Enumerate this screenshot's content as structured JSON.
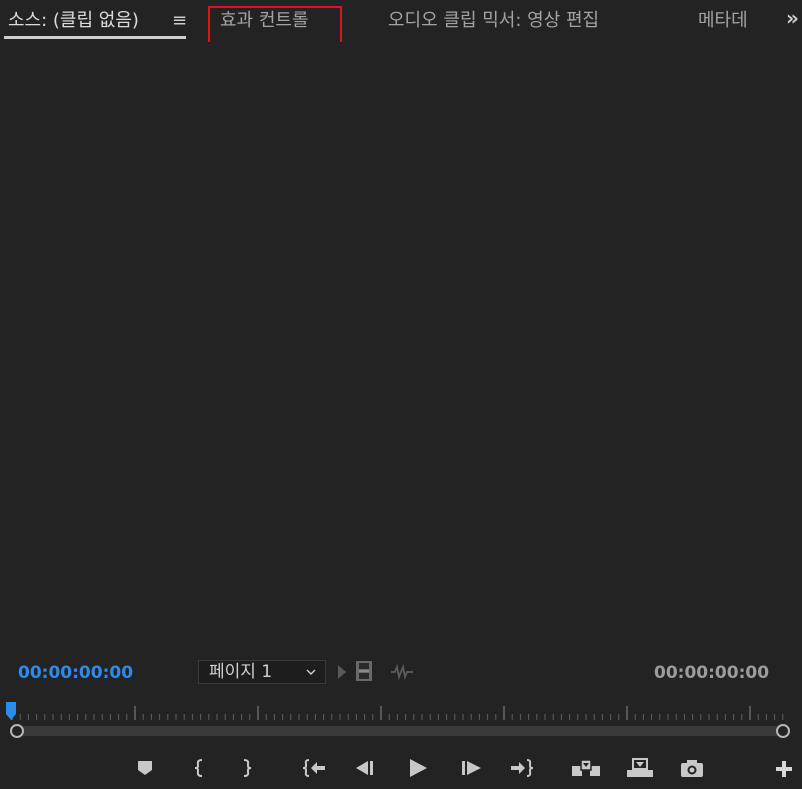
{
  "tabs": [
    {
      "label": "소스: (클립 없음)",
      "active": true
    },
    {
      "label": "효과 컨트롤",
      "active": false
    },
    {
      "label": "오디오 클립 믹서: 영상 편집",
      "active": false
    },
    {
      "label": "메타데",
      "active": false
    }
  ],
  "tab_menu_glyph": "≡",
  "tab_overflow_glyph": "»",
  "highlight_color": "#e5121b",
  "timecode": {
    "current": "00:00:00:00",
    "duration": "00:00:00:00"
  },
  "page_select": {
    "value": "페이지 1"
  },
  "colors": {
    "accent_blue": "#2d8ceb",
    "background": "#232323"
  },
  "controls": [
    "add-marker-icon",
    "mark-in-icon",
    "mark-out-icon",
    "go-to-in-icon",
    "step-back-icon",
    "play-icon",
    "step-forward-icon",
    "go-to-out-icon",
    "insert-icon",
    "overwrite-icon",
    "export-frame-icon",
    "button-editor-plus-icon"
  ]
}
